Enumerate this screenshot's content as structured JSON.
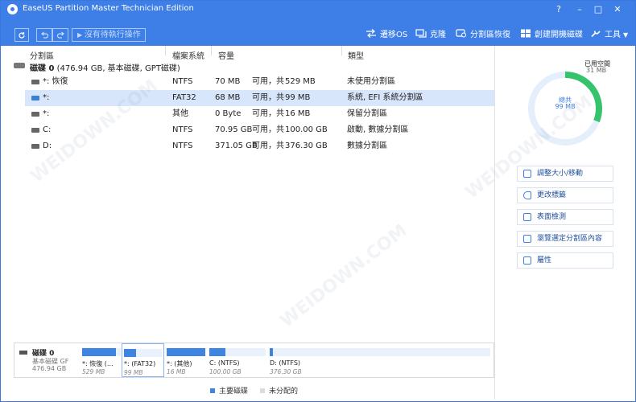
{
  "window": {
    "title": "EaseUS Partition Master Technician Edition",
    "controls": {
      "help": "?",
      "minimize": "–",
      "maximize": "□",
      "close": "✕"
    }
  },
  "toolbar": {
    "refresh_icon": "refresh-icon",
    "undo_icon": "undo-icon",
    "redo_icon": "redo-icon",
    "pending_label": "沒有待執行操作",
    "actions": [
      {
        "label": "遷移OS",
        "icon": "migrate-os-icon"
      },
      {
        "label": "克隆",
        "icon": "clone-icon"
      },
      {
        "label": "分割區恢復",
        "icon": "partition-recovery-icon"
      },
      {
        "label": "創建開機磁碟",
        "icon": "windows-icon"
      },
      {
        "label": "工具",
        "icon": "tools-icon"
      }
    ]
  },
  "table": {
    "headers": {
      "partition": "分割區",
      "filesystem": "檔案系統",
      "capacity": "容量",
      "type": "類型"
    },
    "disk": {
      "label": "磁碟 0",
      "info": "(476.94 GB, 基本磁碟, GPT磁碟)"
    },
    "rows": [
      {
        "name": "*: 恢復",
        "fs": "NTFS",
        "used": "70 MB",
        "of": "可用，共",
        "total": "529 MB",
        "type": "未使用分割區",
        "selected": false
      },
      {
        "name": "*:",
        "fs": "FAT32",
        "used": "68 MB",
        "of": "可用，共",
        "total": "99 MB",
        "type": "系統, EFI 系統分割區",
        "selected": true
      },
      {
        "name": "*:",
        "fs": "其他",
        "used": "0 Byte",
        "of": "可用，共",
        "total": "16 MB",
        "type": "保留分割區",
        "selected": false
      },
      {
        "name": "C:",
        "fs": "NTFS",
        "used": "70.95 GB",
        "of": "可用，共",
        "total": "100.00 GB",
        "type": "啟動, 數據分割區",
        "selected": false
      },
      {
        "name": "D:",
        "fs": "NTFS",
        "used": "371.05 GB",
        "of": "可用，共",
        "total": "376.30 GB",
        "type": "數據分割區",
        "selected": false
      }
    ]
  },
  "disk_map": {
    "name": "磁碟 0",
    "type": "基本磁碟 GF",
    "size": "476.94 GB",
    "segments": [
      {
        "name": "*: 恢復 (...",
        "size": "529 MB",
        "fill": 0.87
      },
      {
        "name": "*: (FAT32)",
        "size": "99 MB",
        "fill": 0.31
      },
      {
        "name": "*: (其他)",
        "size": "16 MB",
        "fill": 1.0
      },
      {
        "name": "C: (NTFS)",
        "size": "100.00 GB",
        "fill": 0.29
      },
      {
        "name": "D: (NTFS)",
        "size": "376.30 GB",
        "fill": 0.014
      }
    ]
  },
  "legend": {
    "primary": "主要磁碟",
    "unallocated": "未分配的"
  },
  "usage": {
    "used_label": "已用空間",
    "used_value": "31 MB",
    "total_label": "總共",
    "total_value": "99 MB",
    "used_fraction": 0.31
  },
  "side_actions": [
    {
      "label": "調整大小/移動",
      "icon": "resize-icon"
    },
    {
      "label": "更改標籤",
      "icon": "tag-icon"
    },
    {
      "label": "表面檢測",
      "icon": "surface-test-icon"
    },
    {
      "label": "瀏覽選定分割區內容",
      "icon": "browse-folder-icon"
    },
    {
      "label": "屬性",
      "icon": "properties-icon"
    }
  ],
  "colors": {
    "accent": "#3d7fe6",
    "ring_used": "#35c36b",
    "ring_track": "#e4effb",
    "selection": "#d7e6fb"
  }
}
